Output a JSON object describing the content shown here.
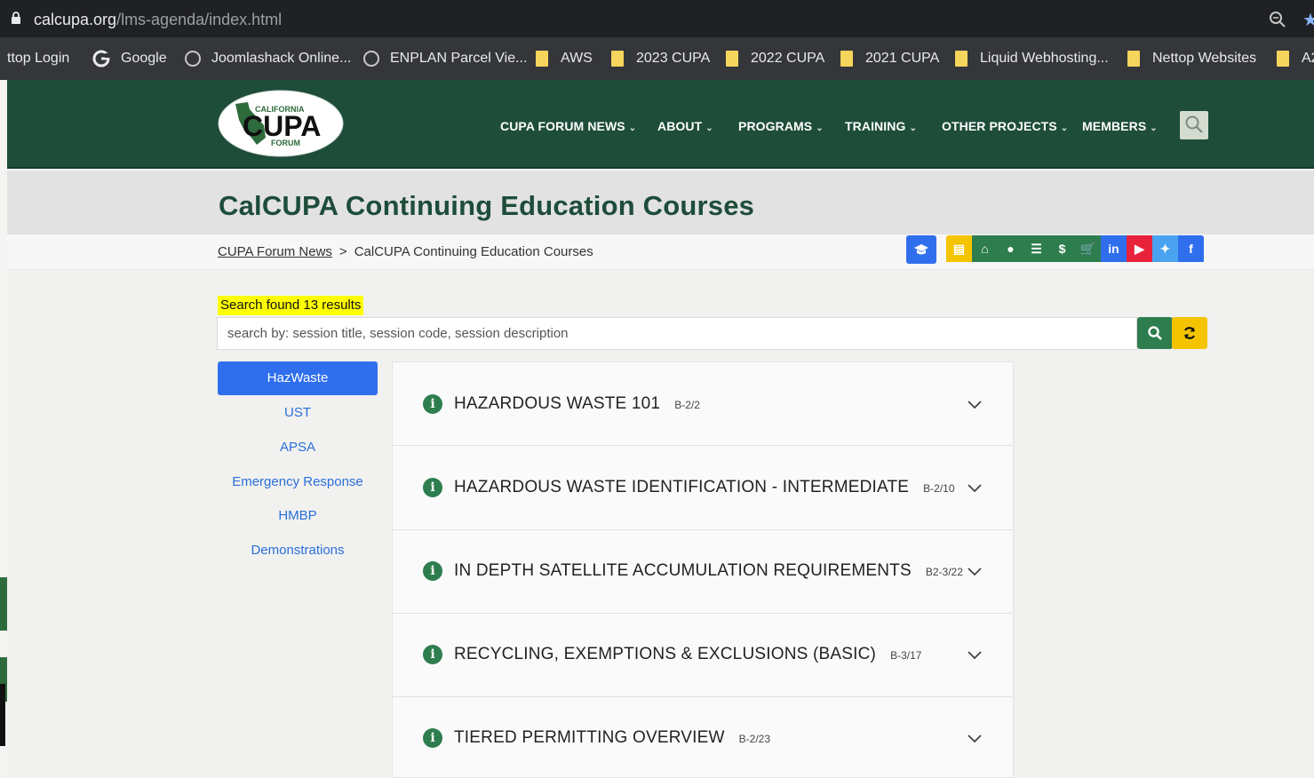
{
  "browser": {
    "url_host": "calcupa.org",
    "url_path": "/lms-agenda/index.html",
    "bookmarks": [
      {
        "label": "ttop Login",
        "icon": "none"
      },
      {
        "label": "Google",
        "icon": "google-icon"
      },
      {
        "label": "Joomlashack Online...",
        "icon": "globe-icon"
      },
      {
        "label": "ENPLAN Parcel Vie...",
        "icon": "globe-icon"
      },
      {
        "label": "AWS",
        "icon": "folder-icon"
      },
      {
        "label": "2023 CUPA",
        "icon": "folder-icon"
      },
      {
        "label": "2022 CUPA",
        "icon": "folder-icon"
      },
      {
        "label": "2021 CUPA",
        "icon": "folder-icon"
      },
      {
        "label": "Liquid Webhosting...",
        "icon": "folder-icon"
      },
      {
        "label": "Nettop Websites",
        "icon": "folder-icon"
      },
      {
        "label": "A2",
        "icon": "folder-icon"
      }
    ]
  },
  "site": {
    "logo": {
      "top": "CALIFORNIA",
      "main": "CUPA",
      "bottom": "FORUM"
    },
    "nav": [
      "CUPA FORUM NEWS",
      "ABOUT",
      "PROGRAMS",
      "TRAINING",
      "OTHER PROJECTS",
      "MEMBERS"
    ],
    "colors": {
      "header": "#1e4d3a",
      "accent_blue": "#2f6fed",
      "search_green": "#2e7d4f",
      "reset_yellow": "#f5c400",
      "highlight": "#ffff00"
    }
  },
  "page": {
    "title": "CalCUPA Continuing Education Courses",
    "breadcrumb": {
      "parent": "CUPA Forum News",
      "separator": ">",
      "current": "CalCUPA Continuing Education Courses"
    }
  },
  "social_icons": [
    {
      "name": "graduation-cap-icon",
      "color": "#2f6fed",
      "glyph": "🎓"
    },
    {
      "name": "calendar-icon",
      "color": "#f5c400",
      "glyph": "▤"
    },
    {
      "name": "home-icon",
      "color": "#2e7d4f",
      "glyph": "⌂"
    },
    {
      "name": "user-icon",
      "color": "#2e7d4f",
      "glyph": "●"
    },
    {
      "name": "list-icon",
      "color": "#2e7d4f",
      "glyph": "☰"
    },
    {
      "name": "dollar-icon",
      "color": "#2e7d4f",
      "glyph": "$"
    },
    {
      "name": "cart-icon",
      "color": "#2e7d4f",
      "glyph": "🛒"
    },
    {
      "name": "linkedin-icon",
      "color": "#2f6fed",
      "glyph": "in"
    },
    {
      "name": "youtube-icon",
      "color": "#e8223a",
      "glyph": "▶"
    },
    {
      "name": "twitter-icon",
      "color": "#4aa3f0",
      "glyph": "✦"
    },
    {
      "name": "facebook-icon",
      "color": "#2f6fed",
      "glyph": "f"
    }
  ],
  "search": {
    "results_text": "Search found 13 results",
    "placeholder": "search by: session title, session code, session description"
  },
  "categories": [
    "HazWaste",
    "UST",
    "APSA",
    "Emergency Response",
    "HMBP",
    "Demonstrations"
  ],
  "active_category": "HazWaste",
  "courses": [
    {
      "title": "HAZARDOUS WASTE 101",
      "code": "B-2/2"
    },
    {
      "title": "HAZARDOUS WASTE IDENTIFICATION - INTERMEDIATE",
      "code": "B-2/10"
    },
    {
      "title": "IN DEPTH SATELLITE ACCUMULATION REQUIREMENTS",
      "code": "B2-3/22"
    },
    {
      "title": "RECYCLING, EXEMPTIONS & EXCLUSIONS (BASIC)",
      "code": "B-3/17"
    },
    {
      "title": "TIERED PERMITTING OVERVIEW",
      "code": "B-2/23"
    }
  ]
}
